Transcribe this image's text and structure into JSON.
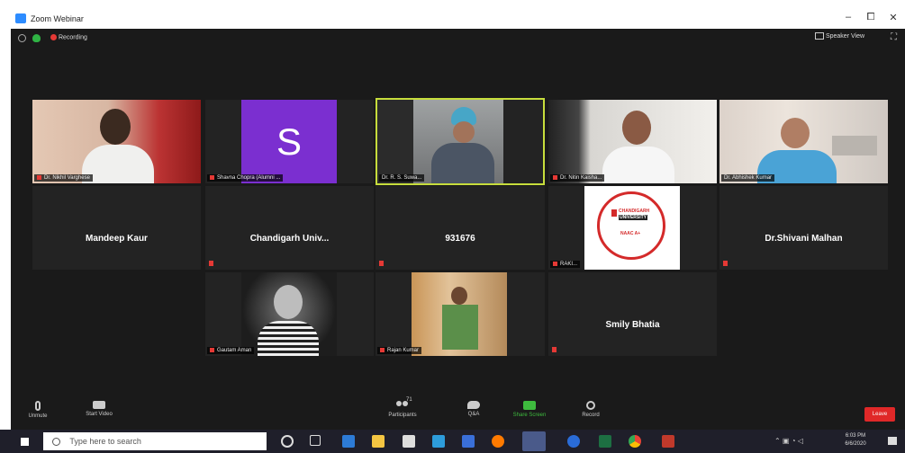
{
  "window": {
    "title": "Zoom Webinar",
    "minimize": "–",
    "maximize": "⧠",
    "close": "✕"
  },
  "topbar": {
    "recording": "Recording",
    "view": "Speaker View"
  },
  "participants": [
    {
      "name": "Dr. Nikhil Varghese"
    },
    {
      "name": "Shavna Chopra (Alumni ...",
      "initial": "S"
    },
    {
      "name": "Dr. R. S. Suwa..."
    },
    {
      "name": "Dr. Nitin Kaisha..."
    },
    {
      "name": "Dr. Abhishek Kumar"
    },
    {
      "name": "Mandeep Kaur"
    },
    {
      "name": "Chandigarh Univ..."
    },
    {
      "name": "931676"
    },
    {
      "name": "RAKI..."
    },
    {
      "name": "Dr.Shivani Malhan"
    },
    {
      "name": "Gautam Aman"
    },
    {
      "name": "Rajan Kumar"
    },
    {
      "name": "Smily Bhatia"
    }
  ],
  "logo": {
    "line1": "CHANDIGARH",
    "line2": "UNIVERSITY",
    "badge": "NAAC A+"
  },
  "controls": {
    "unmute": "Unmute",
    "start_video": "Start Video",
    "participants": "Participants",
    "participants_count": "71",
    "qa": "Q&A",
    "share_screen": "Share Screen",
    "record": "Record",
    "leave": "Leave"
  },
  "taskbar": {
    "search_placeholder": "Type here to search",
    "time": "6:03 PM",
    "date": "6/6/2020"
  },
  "colors": {
    "active_speaker": "#c7dd3c",
    "purple_avatar": "#7b2fd0",
    "leave": "#e02828",
    "share": "#3ebb3e"
  }
}
